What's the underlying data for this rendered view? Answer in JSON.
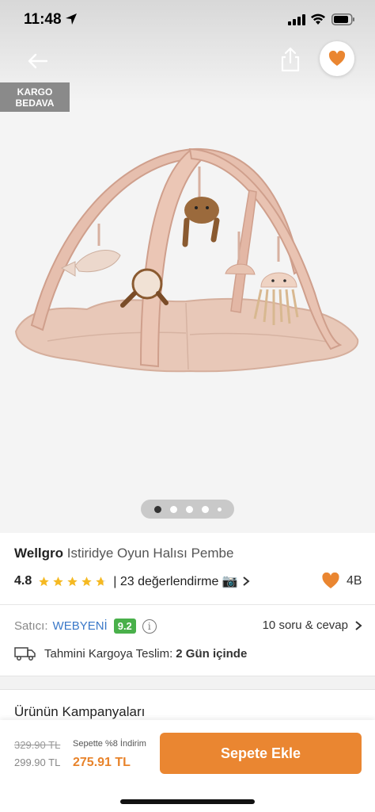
{
  "status_bar": {
    "time": "11:48"
  },
  "badge": {
    "line1": "KARGO",
    "line2": "BEDAVA"
  },
  "product": {
    "brand": "Wellgro",
    "name": "Istiridye Oyun Halısı Pembe",
    "rating": "4.8",
    "star_count": 5,
    "reviews": "| 23 değerlendirme 📷",
    "likes": "4B"
  },
  "gallery": {
    "total": 5,
    "active_index": 0
  },
  "seller": {
    "label": "Satıcı:",
    "name": "WEBYENİ",
    "score": "9.2",
    "qa": "10 soru & cevap"
  },
  "delivery": {
    "label": "Tahmini Kargoya Teslim:",
    "value": "2 Gün içinde"
  },
  "campaign": {
    "title": "Ürünün Kampanyaları"
  },
  "bottom": {
    "old_price": "329.90 TL",
    "mid_price": "299.90 TL",
    "cart_discount": "Sepette %8 İndirim",
    "final_price": "275.91 TL",
    "add_button": "Sepete Ekle"
  },
  "colors": {
    "accent": "#ea8631",
    "seller_link": "#3a78c8",
    "score_badge": "#49b04a"
  }
}
